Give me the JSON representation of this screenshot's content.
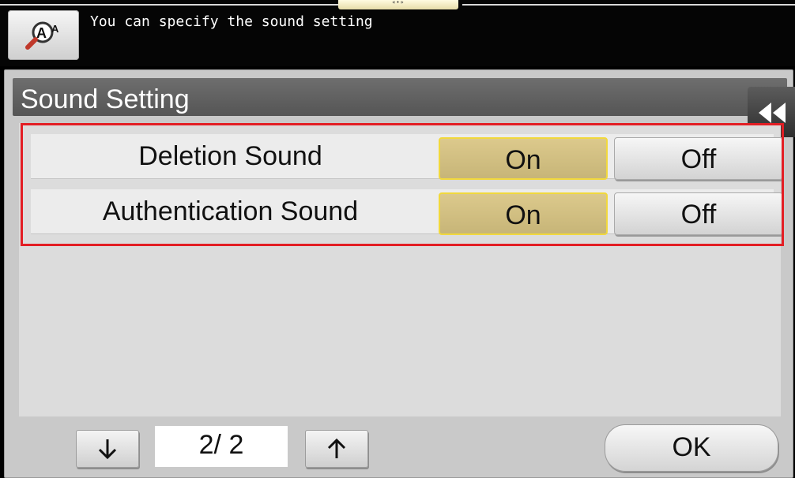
{
  "header": {
    "message": "You can specify the sound setting",
    "handle_glyph": "«•»",
    "accessibility_icon": "accessibility-magnifier-icon"
  },
  "panel": {
    "title": "Sound Setting",
    "collapse_icon": "double-chevron-left-icon"
  },
  "settings": [
    {
      "label": "Deletion Sound",
      "on_label": "On",
      "off_label": "Off",
      "selected": "On"
    },
    {
      "label": "Authentication Sound",
      "on_label": "On",
      "off_label": "Off",
      "selected": "On"
    }
  ],
  "pagination": {
    "page_text": "2/ 2",
    "down_icon": "arrow-down-icon",
    "up_icon": "arrow-up-icon"
  },
  "footer": {
    "ok_label": "OK"
  },
  "colors": {
    "selected_border": "#f1d83d",
    "highlight_outline": "#e31e24",
    "title_bar": "#5f5f5f"
  }
}
